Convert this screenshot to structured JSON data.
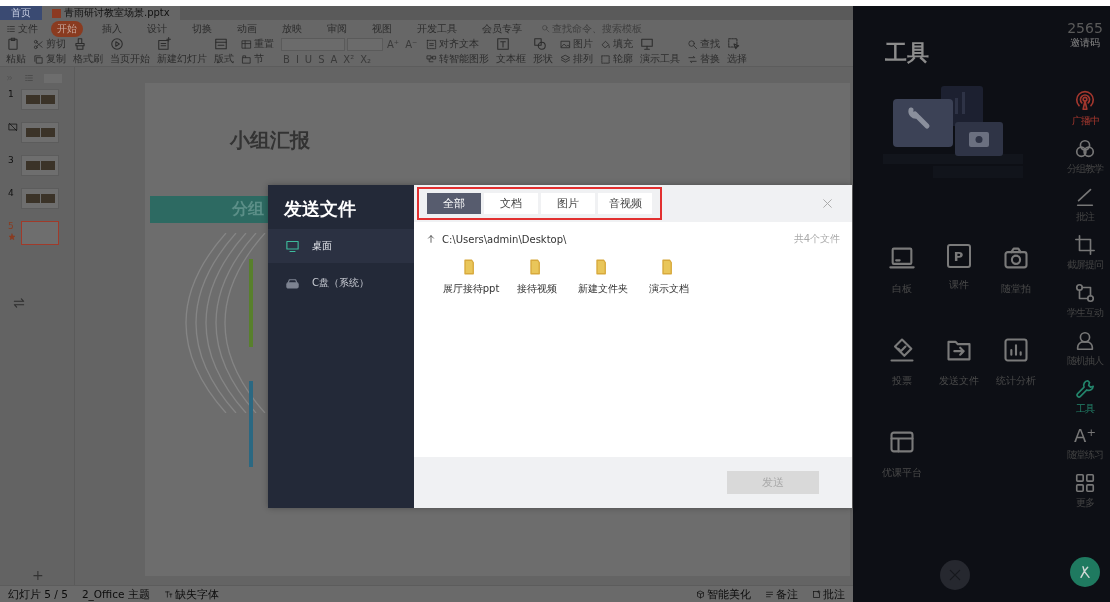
{
  "tab_bar": {
    "home": "首页",
    "file": "青雨研讨教室场景.pptx"
  },
  "menu": {
    "file": "文件",
    "tabs": [
      {
        "label": "开始",
        "selected": true
      },
      {
        "label": "插入",
        "selected": false
      },
      {
        "label": "设计",
        "selected": false
      },
      {
        "label": "切换",
        "selected": false
      },
      {
        "label": "动画",
        "selected": false
      },
      {
        "label": "放映",
        "selected": false
      },
      {
        "label": "审阅",
        "selected": false
      },
      {
        "label": "视图",
        "selected": false
      },
      {
        "label": "开发工具",
        "selected": false
      },
      {
        "label": "会员专享",
        "selected": false
      }
    ],
    "search_placeholder": "查找命令、搜索模板"
  },
  "ribbon": [
    {
      "kind": "tool",
      "bottom": "粘贴"
    },
    {
      "kind": "tool",
      "top": "剪切",
      "bottom": "复制"
    },
    {
      "kind": "tool",
      "bottom": "格式刷"
    },
    {
      "kind": "tool",
      "bottom": "当页开始"
    },
    {
      "kind": "tool",
      "bottom": "新建幻灯片"
    },
    {
      "kind": "tool",
      "bottom": "版式"
    },
    {
      "kind": "tool",
      "top": "重置",
      "bottom": "节"
    },
    {
      "kind": "font",
      "size_buttons": [
        "A⁺",
        "A⁻"
      ],
      "format_buttons": [
        "B",
        "I",
        "U",
        "S",
        "A",
        "X²",
        "X₂"
      ]
    },
    {
      "kind": "tool",
      "top": "对齐文本",
      "bottom": "转智能图形"
    },
    {
      "kind": "tool",
      "bottom": "文本框"
    },
    {
      "kind": "tool",
      "bottom": "形状"
    },
    {
      "kind": "tool",
      "top": "图片",
      "bottom": "排列"
    },
    {
      "kind": "tool",
      "top": "填充",
      "bottom": "轮廓"
    },
    {
      "kind": "tool",
      "bottom": "演示工具"
    },
    {
      "kind": "tool",
      "top": "查找",
      "bottom": "替换"
    },
    {
      "kind": "tool",
      "bottom": "选择"
    }
  ],
  "slides": [
    {
      "number": "1",
      "selected": false,
      "hidden": false,
      "animated": false
    },
    {
      "selected": false,
      "hidden": true,
      "animated": false
    },
    {
      "number": "3",
      "selected": false,
      "hidden": false,
      "animated": false
    },
    {
      "number": "4",
      "selected": false,
      "hidden": false,
      "animated": false
    },
    {
      "number": "5",
      "selected": true,
      "hidden": false,
      "animated": true
    }
  ],
  "add_slide": "+",
  "slide": {
    "title": "小组汇报",
    "banner": "分组"
  },
  "status_bar": {
    "left": [
      "幻灯片 5 / 5",
      "2_Office 主题",
      "缺失字体"
    ],
    "right": [
      "智能美化",
      "备注",
      "批注"
    ]
  },
  "dialog": {
    "title": "发送文件",
    "sources": [
      {
        "label": "桌面",
        "kind": "desktop",
        "selected": true
      },
      {
        "label": "C盘（系统）",
        "kind": "drive",
        "selected": false
      }
    ],
    "tabs": [
      {
        "label": "全部",
        "selected": true
      },
      {
        "label": "文档",
        "selected": false
      },
      {
        "label": "图片",
        "selected": false
      },
      {
        "label": "音视频",
        "selected": false
      }
    ],
    "path": "C:\\Users\\admin\\Desktop\\",
    "count": "共4个文件",
    "files": [
      {
        "name": "展厅接待ppt"
      },
      {
        "name": "接待视频"
      },
      {
        "name": "新建文件夹"
      },
      {
        "name": "演示文档"
      }
    ],
    "send_button": {
      "label": "发送",
      "disabled": true
    }
  },
  "tools_panel": {
    "title": "工具",
    "tools": [
      {
        "label": "白板"
      },
      {
        "label": "课件",
        "icon_text": "P"
      },
      {
        "label": "随堂拍"
      },
      {
        "label": "投票"
      },
      {
        "label": "发送文件"
      },
      {
        "label": "统计分析"
      },
      {
        "label": "优课平台"
      }
    ]
  },
  "sidebar": {
    "code": "2565",
    "code_label": "邀请码",
    "items": [
      {
        "label": "广播中",
        "live": true,
        "selected": false
      },
      {
        "label": "分组教学",
        "live": false,
        "selected": false
      },
      {
        "label": "批注",
        "live": false,
        "selected": false
      },
      {
        "label": "截屏提问",
        "live": false,
        "selected": false
      },
      {
        "label": "学生互动",
        "live": false,
        "selected": false
      },
      {
        "label": "随机抽人",
        "live": false,
        "selected": false
      },
      {
        "label": "工具",
        "live": false,
        "selected": true
      },
      {
        "label": "随堂练习",
        "icon_text": "A⁺",
        "live": false,
        "selected": false
      },
      {
        "label": "更多",
        "live": false,
        "selected": false
      }
    ]
  }
}
